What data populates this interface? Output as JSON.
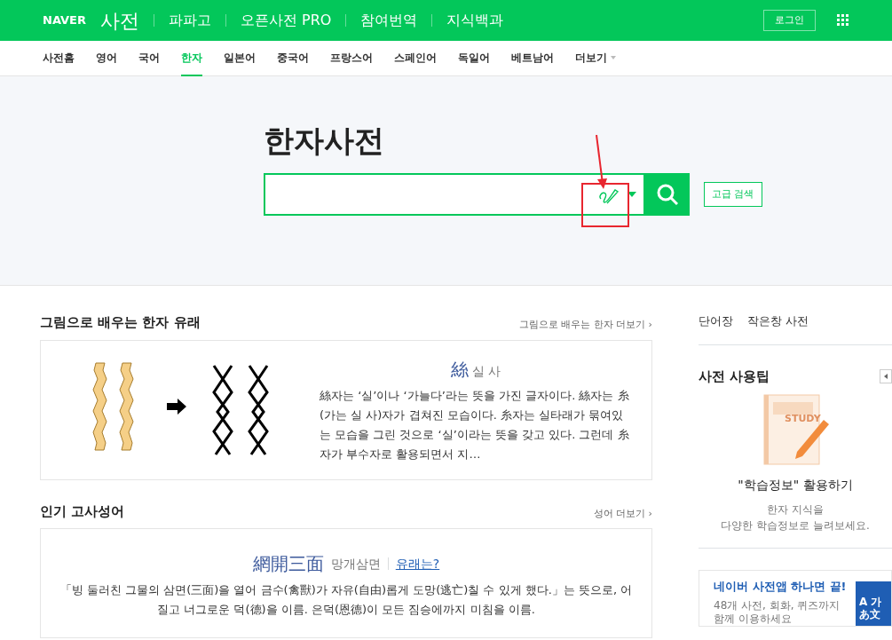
{
  "header": {
    "brand": "NAVER",
    "service": "사전",
    "links": [
      "파파고",
      "오픈사전 PRO",
      "참여번역",
      "지식백과"
    ],
    "login": "로그인"
  },
  "tabs": [
    {
      "label": "사전홈",
      "selected": false
    },
    {
      "label": "영어",
      "selected": false
    },
    {
      "label": "국어",
      "selected": false
    },
    {
      "label": "한자",
      "selected": true
    },
    {
      "label": "일본어",
      "selected": false
    },
    {
      "label": "중국어",
      "selected": false
    },
    {
      "label": "프랑스어",
      "selected": false
    },
    {
      "label": "스페인어",
      "selected": false
    },
    {
      "label": "독일어",
      "selected": false
    },
    {
      "label": "베트남어",
      "selected": false
    },
    {
      "label": "더보기",
      "selected": false,
      "kind": "more"
    }
  ],
  "hero": {
    "title": "한자사전",
    "advanced_search": "고급 검색",
    "annotation": true
  },
  "origin": {
    "title": "그림으로 배우는 한자 유래",
    "more": "그림으로 배우는 한자 더보기 ›",
    "hanja": "絲",
    "reading": "실 사",
    "text": "絲자는 ‘실’이나 ‘가늘다’라는 뜻을 가진 글자이다. 絲자는 糸(가는 실 사)자가 겹쳐진 모습이다. 糸자는 실타래가 묶여있는 모습을 그린 것으로 ‘실’이라는 뜻을 갖고 있다. 그런데 糸자가 부수자로 활용되면서 지…"
  },
  "idiom": {
    "title": "인기 고사성어",
    "more": "성어 더보기 ›",
    "hanja": "網開三面",
    "reading": "망개삼면",
    "link": "유래는?",
    "text": "「빙 둘러친 그물의 삼면(三面)을 열어 금수(禽獸)가 자유(自由)롭게 도망(逃亡)칠 수 있게 했다.」는 뜻으로, 어질고 너그로운 덕(德)을 이름. 은덕(恩德)이 모든 짐승에까지 미침을 이름."
  },
  "side": {
    "links": [
      "단어장",
      "작은창 사전"
    ],
    "tip_title": "사전 사용팁",
    "tip_heading": "\"학습정보\" 활용하기",
    "tip_lines": [
      "한자 지식을",
      "다양한 학습정보로 늘려보세요."
    ],
    "study_label": "STUDY",
    "app_title": "네이버 사전앱 하나면 끝!",
    "app_lines": [
      "48개 사전, 회화, 퀴즈까지",
      "함께 이용하세요"
    ],
    "app_badge": [
      "A 가",
      "あ文"
    ]
  }
}
